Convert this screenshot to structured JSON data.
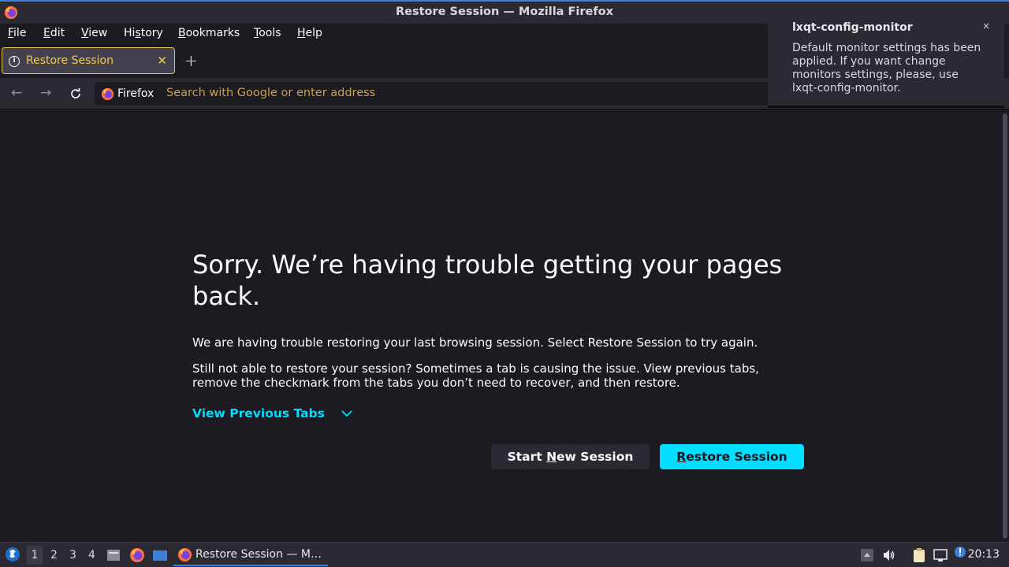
{
  "window": {
    "title": "Restore Session — Mozilla Firefox"
  },
  "menubar": {
    "items": [
      {
        "label": "File",
        "accel": "F"
      },
      {
        "label": "Edit",
        "accel": "E"
      },
      {
        "label": "View",
        "accel": "V"
      },
      {
        "label": "History",
        "accel": "s"
      },
      {
        "label": "Bookmarks",
        "accel": "B"
      },
      {
        "label": "Tools",
        "accel": "T"
      },
      {
        "label": "Help",
        "accel": "H"
      }
    ]
  },
  "tabs": [
    {
      "label": "Restore Session",
      "icon": "info-icon",
      "active": true
    }
  ],
  "urlbar": {
    "identity_label": "Firefox",
    "placeholder": "Search with Google or enter address",
    "value": ""
  },
  "page": {
    "heading": "Sorry. We’re having trouble getting your pages back.",
    "para1": "We are having trouble restoring your last browsing session. Select Restore Session to try again.",
    "para2": "Still not able to restore your session? Sometimes a tab is causing the issue. View previous tabs, remove the checkmark from the tabs you don’t need to recover, and then restore.",
    "view_previous_tabs": "View Previous Tabs",
    "start_new_session_pre": "Start ",
    "start_new_session_accel": "N",
    "start_new_session_post": "ew Session",
    "restore_session_accel": "R",
    "restore_session_post": "estore Session"
  },
  "notification": {
    "title": "lxqt-config-monitor",
    "body": "Default monitor settings has been applied. If you want change monitors settings, please, use lxqt-config-monitor.",
    "close": "×"
  },
  "taskbar": {
    "workspaces": [
      "1",
      "2",
      "3",
      "4"
    ],
    "active_workspace": "1",
    "task_label": "Restore Session — M…",
    "clock": "20:13"
  },
  "colors": {
    "accent": "#00ddff",
    "tab_text": "#f3c84d",
    "background": "#1c1b22"
  }
}
